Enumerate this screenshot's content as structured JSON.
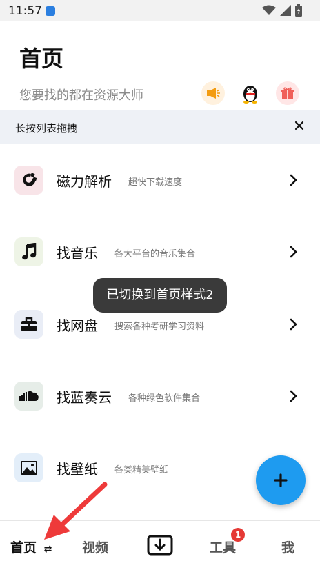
{
  "status_bar": {
    "time": "11:57"
  },
  "header": {
    "title": "首页",
    "subtitle": "您要找的都在资源大师",
    "icons": [
      "horn-icon",
      "qq-penguin-icon",
      "gift-icon"
    ]
  },
  "notice": {
    "text": "长按列表拖拽"
  },
  "list": [
    {
      "title": "磁力解析",
      "desc": "超快下载速度",
      "icon": "magnet-icon"
    },
    {
      "title": "找音乐",
      "desc": "各大平台的音乐集合",
      "icon": "music-note-icon"
    },
    {
      "title": "找网盘",
      "desc": "搜索各种考研学习资料",
      "icon": "briefcase-icon"
    },
    {
      "title": "找蓝奏云",
      "desc": "各种绿色软件集合",
      "icon": "soundcloud-icon"
    },
    {
      "title": "找壁纸",
      "desc": "各类精美壁纸",
      "icon": "image-icon"
    }
  ],
  "toast": {
    "text": "已切换到首页样式2"
  },
  "bottom_nav": {
    "home": "首页",
    "home_swap": "⇄",
    "video": "视频",
    "tools": "工具",
    "tools_badge": "1",
    "me": "我"
  },
  "colors": {
    "accent": "#1e9bf0",
    "badge": "#e53935",
    "annotation_arrow": "#ee3a3a"
  }
}
